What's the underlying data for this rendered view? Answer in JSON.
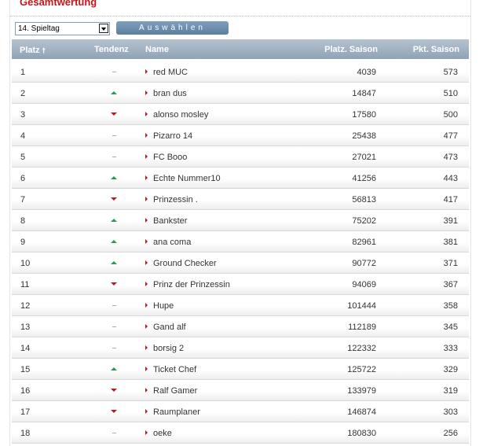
{
  "header": {
    "title": "Gesamtwertung"
  },
  "controls": {
    "select_value": "14. Spieltag",
    "submit_label": "Auswählen"
  },
  "table": {
    "columns": {
      "rank": "Platz",
      "trend": "Tendenz",
      "name": "Name",
      "season_place": "Platz. Saison",
      "season_points": "Pkt. Saison"
    },
    "sort_icon": "sort-up-arrow-icon",
    "colors": {
      "up": "#2a9a5a",
      "down": "#c4151c",
      "same": "#aaaaaa",
      "accent": "#c4151c"
    },
    "rows": [
      {
        "rank": "1",
        "trend": "same",
        "name": "red MUC",
        "place": "4039",
        "points": "573"
      },
      {
        "rank": "2",
        "trend": "up",
        "name": "bran dus",
        "place": "14847",
        "points": "510"
      },
      {
        "rank": "3",
        "trend": "down",
        "name": "alonso mosley",
        "place": "17580",
        "points": "500"
      },
      {
        "rank": "4",
        "trend": "same",
        "name": "Pizarro 14",
        "place": "25438",
        "points": "477"
      },
      {
        "rank": "5",
        "trend": "same",
        "name": "FC Booo",
        "place": "27021",
        "points": "473"
      },
      {
        "rank": "6",
        "trend": "up",
        "name": "Echte Nummer10",
        "place": "41256",
        "points": "443"
      },
      {
        "rank": "7",
        "trend": "down",
        "name": "Prinzessin .",
        "place": "56813",
        "points": "417"
      },
      {
        "rank": "8",
        "trend": "up",
        "name": "Bankster",
        "place": "75202",
        "points": "391"
      },
      {
        "rank": "9",
        "trend": "up",
        "name": "ana coma",
        "place": "82961",
        "points": "381"
      },
      {
        "rank": "10",
        "trend": "up",
        "name": "Ground Checker",
        "place": "90772",
        "points": "371"
      },
      {
        "rank": "11",
        "trend": "down",
        "name": "Prinz der Prinzessin",
        "place": "94069",
        "points": "367"
      },
      {
        "rank": "12",
        "trend": "same",
        "name": "Hupe",
        "place": "101444",
        "points": "358"
      },
      {
        "rank": "13",
        "trend": "same",
        "name": "Gand alf",
        "place": "112189",
        "points": "345"
      },
      {
        "rank": "14",
        "trend": "same",
        "name": "borsig 2",
        "place": "122332",
        "points": "333"
      },
      {
        "rank": "15",
        "trend": "up",
        "name": "Ticket Chef",
        "place": "125722",
        "points": "329"
      },
      {
        "rank": "16",
        "trend": "down",
        "name": "Ralf Gamer",
        "place": "133979",
        "points": "319"
      },
      {
        "rank": "17",
        "trend": "down",
        "name": "Raumplaner",
        "place": "146874",
        "points": "303"
      },
      {
        "rank": "18",
        "trend": "same",
        "name": "oeke",
        "place": "180830",
        "points": "256"
      }
    ]
  }
}
